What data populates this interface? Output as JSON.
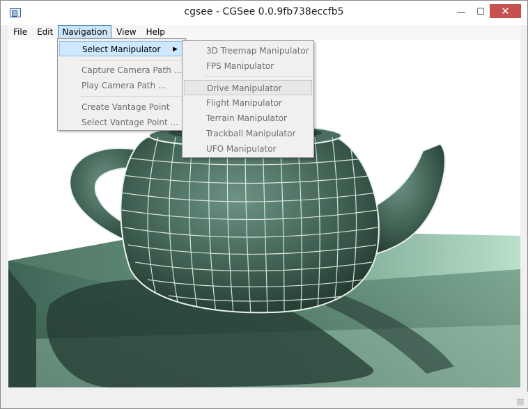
{
  "window": {
    "title": "cgsee - CGSee 0.0.9fb738eccfb5",
    "controls": {
      "minimize": "—",
      "maximize": "☐",
      "close": "✕"
    }
  },
  "menubar": {
    "items": [
      "File",
      "Edit",
      "Navigation",
      "View",
      "Help"
    ],
    "active": "Navigation"
  },
  "navigation_menu": {
    "items": [
      {
        "label": "Select Manipulator",
        "arrow": "▶"
      },
      {
        "label": "Capture Camera Path ..."
      },
      {
        "label": "Play Camera Path ..."
      },
      {
        "label": "Create Vantage Point"
      },
      {
        "label": "Select Vantage Point ..."
      }
    ]
  },
  "manipulator_submenu": {
    "items": [
      {
        "label": "3D Treemap Manipulator"
      },
      {
        "label": "FPS Manipulator"
      },
      {
        "label": "Drive Manipulator",
        "selected": true
      },
      {
        "label": "Flight Manipulator"
      },
      {
        "label": "Terrain Manipulator"
      },
      {
        "label": "Trackball Manipulator"
      },
      {
        "label": "UFO Manipulator"
      }
    ]
  },
  "viewport": {
    "content": "teapot-render",
    "colors": {
      "surface": "#3d5e4f",
      "wire": "#e8f2ec",
      "floor": "#6f9c86",
      "floor_light": "#a9d2bd",
      "shadow": "#2c4438"
    }
  }
}
